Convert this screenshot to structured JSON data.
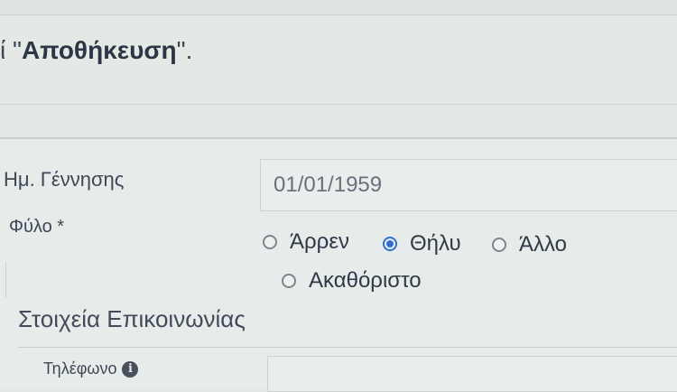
{
  "notice": {
    "prefix": "ί \"",
    "button_name": "Αποθήκευση",
    "suffix": "\"."
  },
  "form": {
    "dob": {
      "label": "Ημ. Γέννησης",
      "value": "01/01/1959"
    },
    "gender": {
      "label": "Φύλο *",
      "options": [
        {
          "label": "Άρρεν",
          "checked": false
        },
        {
          "label": "Θήλυ",
          "checked": true
        },
        {
          "label": "Άλλο",
          "checked": false
        },
        {
          "label": "Ακαθόριστο",
          "checked": false
        }
      ]
    }
  },
  "contact": {
    "heading": "Στοιχεία Επικοινωνίας",
    "phone": {
      "label": "Τηλέφωνο",
      "value": ""
    }
  },
  "icons": {
    "phone_info": "info-circle-icon"
  },
  "colors": {
    "accent": "#2f6fd1",
    "background": "#e4e9e6"
  }
}
